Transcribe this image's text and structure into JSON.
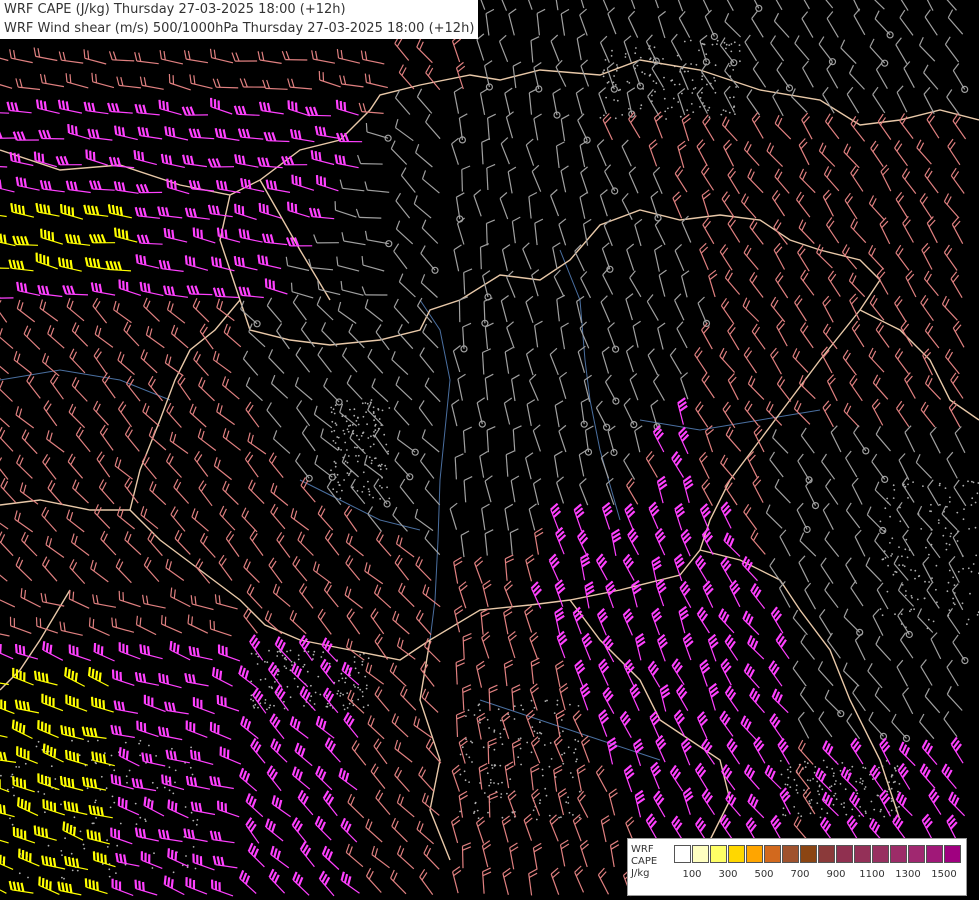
{
  "titles": {
    "line1": "WRF CAPE (J/kg) Thursday 27-03-2025 18:00 (+12h)",
    "line2": "WRF Wind shear (m/s) 500/1000hPa Thursday 27-03-2025 18:00 (+12h)"
  },
  "legend": {
    "title_lines": [
      "WRF",
      "CAPE",
      "J/kg"
    ],
    "colors": [
      "#ffffff",
      "#ffffc0",
      "#ffff66",
      "#ffd700",
      "#ffa500",
      "#d2691e",
      "#a0522d",
      "#8b4513",
      "#8b3a3a",
      "#903050",
      "#943058",
      "#983060",
      "#9c2c68",
      "#a02870",
      "#a01878",
      "#a00080"
    ],
    "tick_labels": [
      "100",
      "300",
      "500",
      "700",
      "900",
      "1100",
      "1300",
      "1500"
    ]
  },
  "colors": {
    "background": "#000000",
    "barb_weak": "#a0a0a0",
    "barb_medium": "#e08080",
    "barb_strong": "#ff40ff",
    "barb_extreme": "#ffff00",
    "border": "#e8c8a8",
    "river": "#4a6fa0",
    "terrain": "#b0b0b0"
  }
}
